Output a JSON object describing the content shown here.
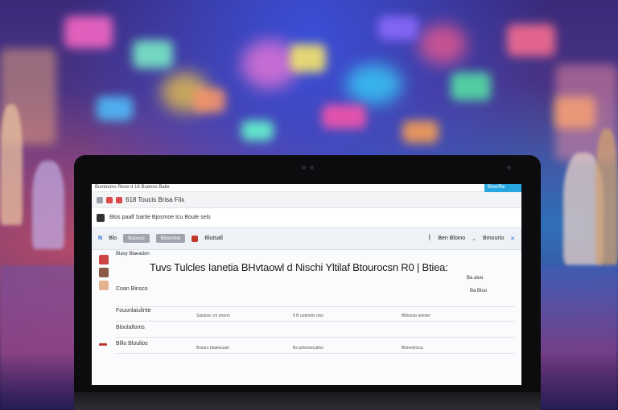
{
  "window": {
    "title": "Bustoums Reve d 16 Buenos Baile",
    "accent_label": "Bioo/Re"
  },
  "tabbar": {
    "label": "618 Toucis Brisa Filx"
  },
  "urlbar": {
    "text": "Blos paalf Sartie Bjosmoe tcu Boule sels"
  },
  "toolbar": {
    "brand": "N",
    "button1": "Blo",
    "button2": "Baouso",
    "button3": "Blosmine",
    "label": "Blutsall",
    "sort_label": "Ben Bloino",
    "filter_label": "Bmourio"
  },
  "content": {
    "breadcrumb": "Blasy Blaeadon",
    "headline": "Tuvs Tulcles Ianetia BHvtaowl d Nischi Yltilaf Btourocsn R0 | Btiea:",
    "side_note1": "Ba  aluo",
    "side_note2": "Ba Bluo",
    "row1_label": "Coan Binsco",
    "row2_label": "Fouunlaiulinte",
    "row3_label": "Bloulalloms",
    "row4_label": "Blllo Bloulios",
    "row2_ticks": [
      "Sulutioe cnr doonn",
      "¢ B outlontis nivo",
      "Bllinouto anioter"
    ],
    "row4_ticks": [
      "Bssuro biaieeiuaie",
      "Bs arlonisecutino",
      "Bloieeilocca"
    ]
  }
}
